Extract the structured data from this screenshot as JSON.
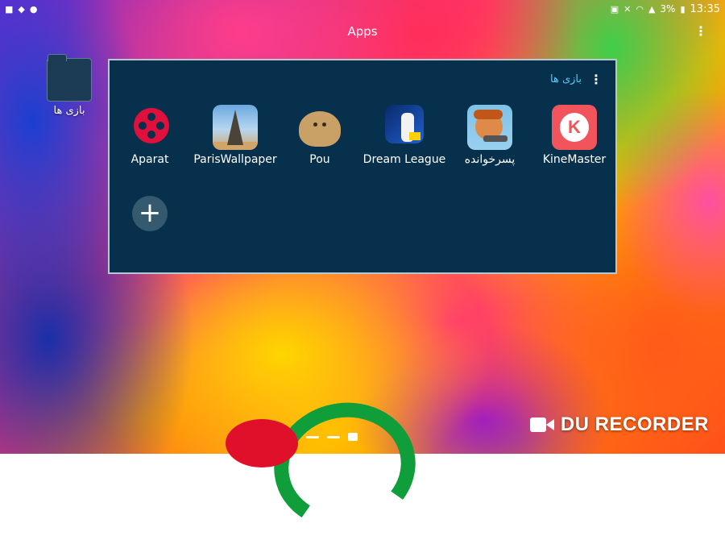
{
  "statusbar": {
    "time": "13:35",
    "battery": "3%",
    "left_icons": [
      "video-call-icon",
      "hat-icon",
      "chat-icon"
    ],
    "right_icons": [
      "screen-cast-icon",
      "mute-icon",
      "wifi-icon",
      "signal-icon",
      "battery-icon"
    ]
  },
  "header": {
    "title": "Apps",
    "menu_glyph": "⋮"
  },
  "desktop": {
    "folder_label": "بازی ها"
  },
  "folder": {
    "title": "بازی ها",
    "menu_glyph": "⋮",
    "apps": [
      {
        "label": "Aparat",
        "icon": "aparat-icon"
      },
      {
        "label": "ParisWallpaper",
        "icon": "paris-wallpaper-icon"
      },
      {
        "label": "Pou",
        "icon": "pou-icon"
      },
      {
        "label": "Dream League",
        "icon": "dream-league-icon"
      },
      {
        "label": "پسرخوانده",
        "icon": "pesarkhande-icon"
      },
      {
        "label": "KineMaster",
        "icon": "kinemaster-icon",
        "letter": "K"
      }
    ],
    "add_glyph": "+"
  },
  "watermark": {
    "text": "DU RECORDER"
  },
  "colors": {
    "folder_bg": "#06304b",
    "folder_title": "#5ec7f2",
    "aparat": "#e0103c",
    "kinemaster": "#f2545b"
  }
}
